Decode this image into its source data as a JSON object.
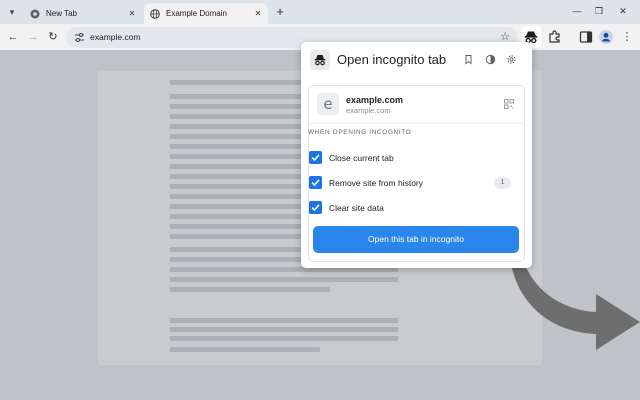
{
  "tabs": [
    {
      "label": "New Tab",
      "active": false
    },
    {
      "label": "Example Domain",
      "active": true
    }
  ],
  "toolbar": {
    "url": "example.com"
  },
  "popup": {
    "title": "Open incognito tab",
    "site": {
      "name": "example.com",
      "url": "example.com",
      "favicon_letter": "e"
    },
    "section_label": "WHEN OPENING INCOGNITO",
    "options": [
      {
        "label": "Close current tab",
        "checked": true
      },
      {
        "label": "Remove site from history",
        "checked": true,
        "count": "1"
      },
      {
        "label": "Clear site data",
        "checked": true
      }
    ],
    "cta_label": "Open this tab in incognito"
  },
  "colors": {
    "accent": "#1a73e8",
    "cta": "#2b86ec",
    "page_dim": "#bfc2c6",
    "arrow": "#6e6e6e"
  }
}
